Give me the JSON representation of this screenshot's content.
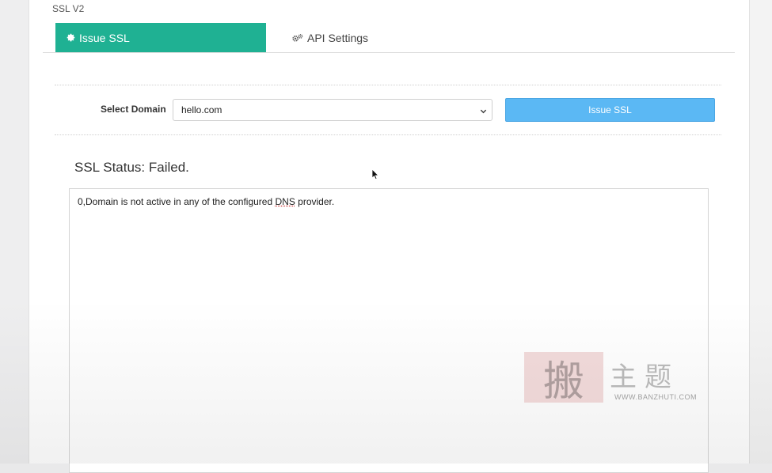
{
  "panel": {
    "title": "SSL V2"
  },
  "tabs": [
    {
      "label": "Issue SSL",
      "icon": "gear-icon",
      "active": true
    },
    {
      "label": "API Settings",
      "icon": "gears-icon",
      "active": false
    }
  ],
  "form": {
    "domain_label": "Select Domain",
    "domain_value": "hello.com",
    "issue_button": "Issue SSL"
  },
  "status": {
    "title": "SSL Status: Failed.",
    "log_prefix": "0,Domain is not active in any of the configured ",
    "log_term": "DNS",
    "log_suffix": " provider."
  },
  "watermark": {
    "stamp": "搬",
    "chars": "主题",
    "url": "WWW.BANZHUTI.COM"
  },
  "colors": {
    "tab_active": "#1fb193",
    "issue_button": "#5bb8f4"
  }
}
